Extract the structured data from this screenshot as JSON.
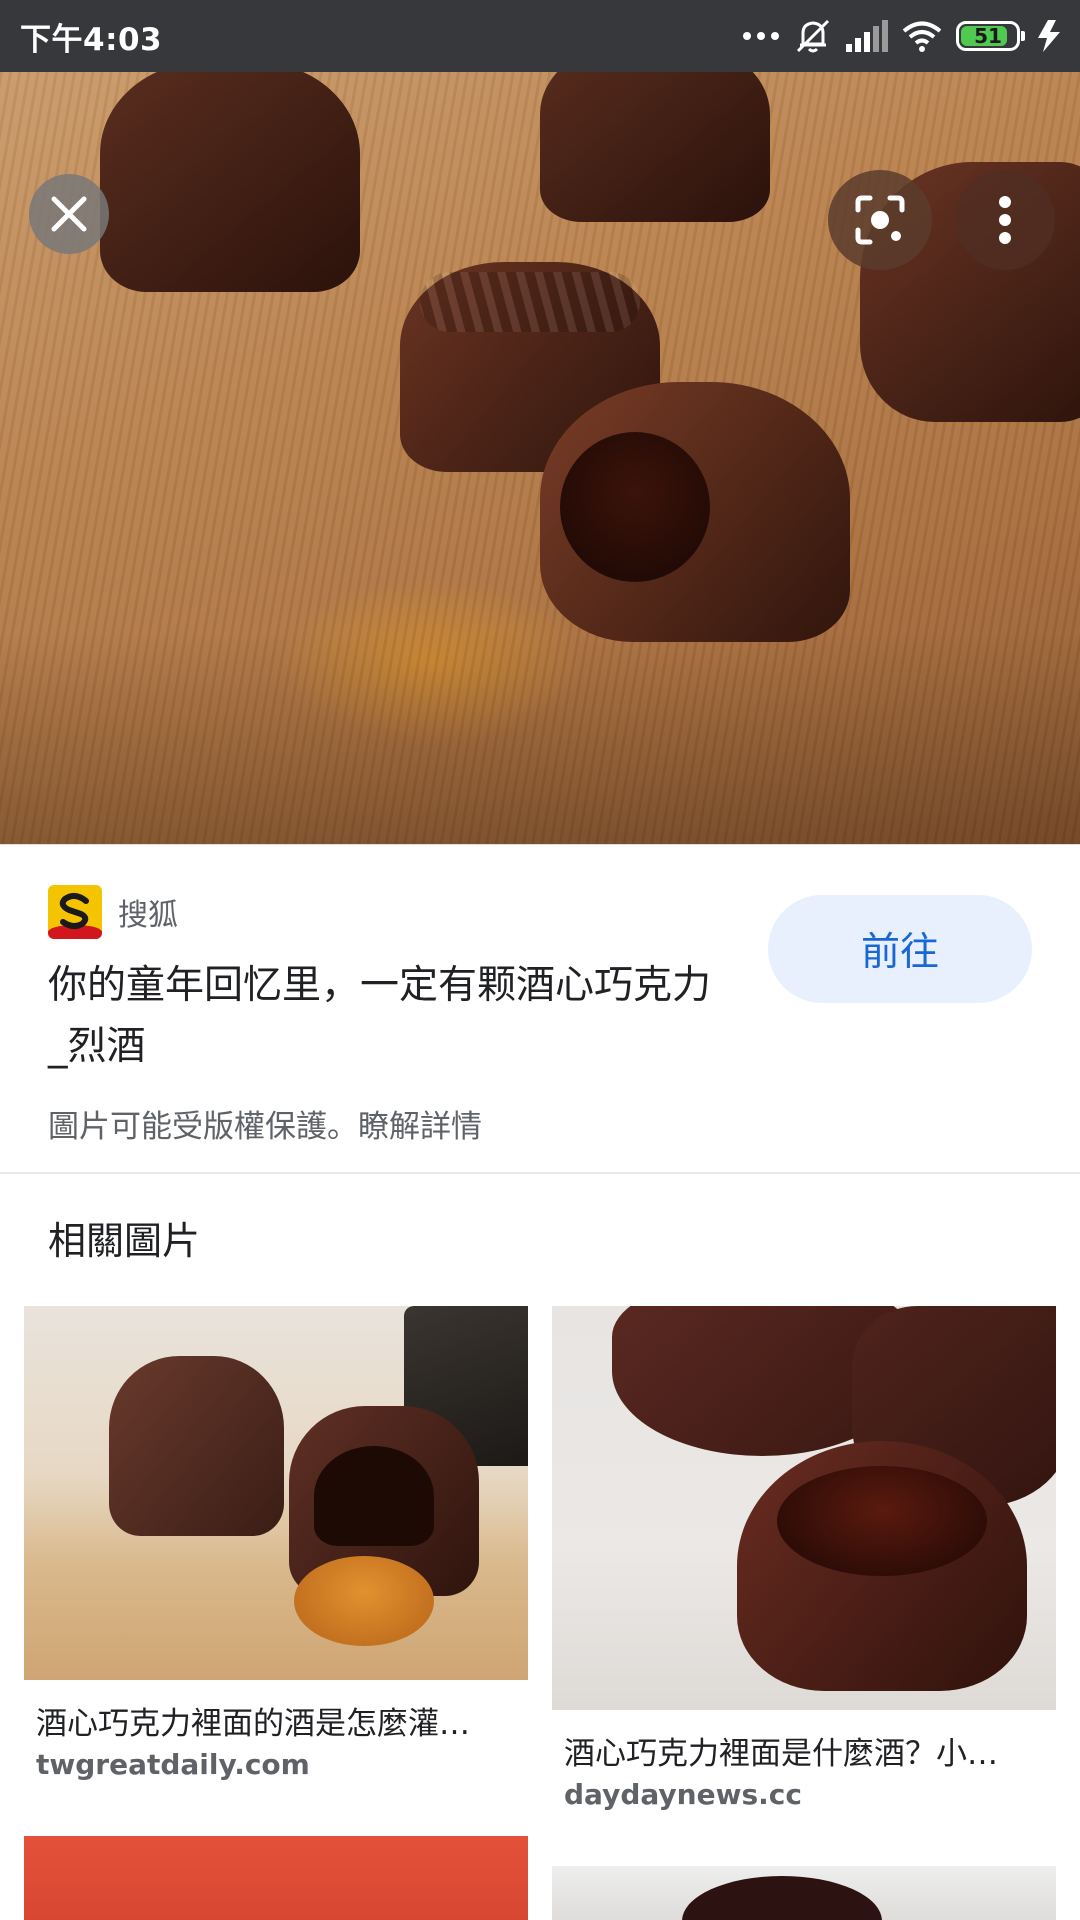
{
  "status_bar": {
    "time": "下午4:03",
    "battery": "51",
    "icons": [
      "more-dots-icon",
      "mute-icon",
      "signal-icon",
      "wifi-icon",
      "battery-icon",
      "charging-icon"
    ]
  },
  "viewer": {
    "buttons": [
      "close-icon",
      "lens-icon",
      "more-vert-icon"
    ]
  },
  "result": {
    "source_name": "搜狐",
    "title": "你的童年回忆里，一定有颗酒心巧克力_烈酒",
    "go_label": "前往",
    "copyright_text": "圖片可能受版權保護。",
    "learn_more": "瞭解詳情"
  },
  "related": {
    "heading": "相關圖片",
    "items": [
      {
        "caption": "酒心巧克力裡面的酒是怎麼灌…",
        "domain": "twgreatdaily.com"
      },
      {
        "caption": "酒心巧克力裡面是什麼酒？小…",
        "domain": "daydaynews.cc"
      }
    ]
  },
  "colors": {
    "status_bar": "#36383b",
    "go_button_bg": "#e8f0fe",
    "go_button_text": "#1967d2",
    "battery_fill": "#4fc94f"
  }
}
